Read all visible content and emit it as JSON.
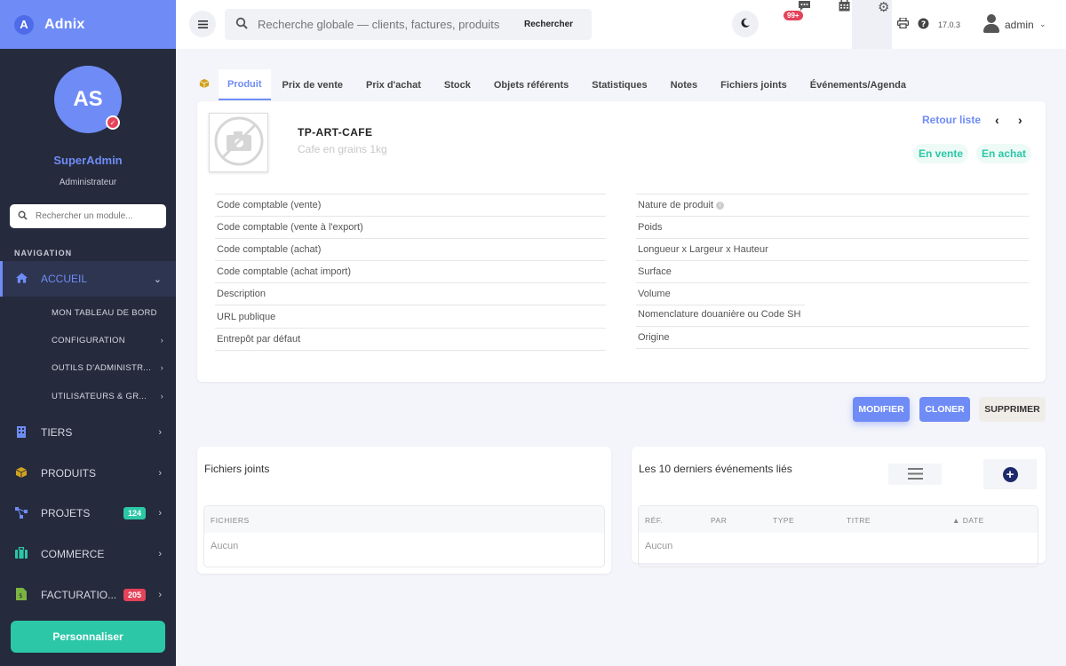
{
  "brand": {
    "name": "Adnix",
    "logo_letter": "A"
  },
  "profile": {
    "initials": "AS",
    "name": "SuperAdmin",
    "role": "Administrateur",
    "badge": "✓"
  },
  "module_search": {
    "placeholder": "Rechercher un module..."
  },
  "nav": {
    "title": "NAVIGATION",
    "items": [
      {
        "label": "ACCUEIL",
        "icon": "home-icon",
        "active": true
      },
      {
        "label": "TIERS",
        "icon": "building-icon"
      },
      {
        "label": "PRODUITS",
        "icon": "box-icon"
      },
      {
        "label": "PROJETS",
        "icon": "project-icon",
        "badge": "124",
        "badge_color": "#2cc7a7"
      },
      {
        "label": "COMMERCE",
        "icon": "briefcase-icon"
      },
      {
        "label": "FACTURATIO...",
        "icon": "invoice-icon",
        "badge": "205",
        "badge_color": "#e4435a"
      }
    ],
    "sub_items": [
      {
        "label": "MON TABLEAU DE BORD"
      },
      {
        "label": "CONFIGURATION"
      },
      {
        "label": "OUTILS D'ADMINISTR..."
      },
      {
        "label": "UTILISATEURS & GR..."
      }
    ]
  },
  "personalize_label": "Personnaliser",
  "topbar": {
    "search_placeholder": "Recherche globale — clients, factures, produits",
    "search_button": "Rechercher",
    "notif_badge": "99+",
    "version": "17.0.3",
    "user": "admin"
  },
  "tabs": [
    {
      "label": "Produit",
      "active": true
    },
    {
      "label": "Prix de vente"
    },
    {
      "label": "Prix d'achat"
    },
    {
      "label": "Stock"
    },
    {
      "label": "Objets référents"
    },
    {
      "label": "Statistiques"
    },
    {
      "label": "Notes"
    },
    {
      "label": "Fichiers joints"
    },
    {
      "label": "Événements/Agenda"
    }
  ],
  "product": {
    "ref": "TP-ART-CAFE",
    "label": "Cafe en grains 1kg",
    "back_link": "Retour liste",
    "status_sell": "En vente",
    "status_buy": "En achat",
    "accent": "#6f8cf6",
    "status_color": "#2cc7a7"
  },
  "fields_left": [
    "Code comptable (vente)",
    "Code comptable (vente à l'export)",
    "Code comptable (achat)",
    "Code comptable (achat import)",
    "Description",
    "URL publique",
    "Entrepôt par défaut"
  ],
  "fields_right": [
    "Nature de produit",
    "Poids",
    "Longueur x Largeur x Hauteur",
    "Surface",
    "Volume",
    "Nomenclature douanière ou Code SH",
    "Origine"
  ],
  "actions": {
    "modify": "MODIFIER",
    "clone": "CLONER",
    "delete": "SUPPRIMER"
  },
  "files": {
    "title": "Fichiers joints",
    "header": "FICHIERS",
    "empty": "Aucun"
  },
  "events": {
    "title": "Les 10 derniers événements liés",
    "columns": [
      "RÉF.",
      "PAR",
      "TYPE",
      "TITRE",
      "▲ DATE"
    ],
    "empty": "Aucun"
  }
}
